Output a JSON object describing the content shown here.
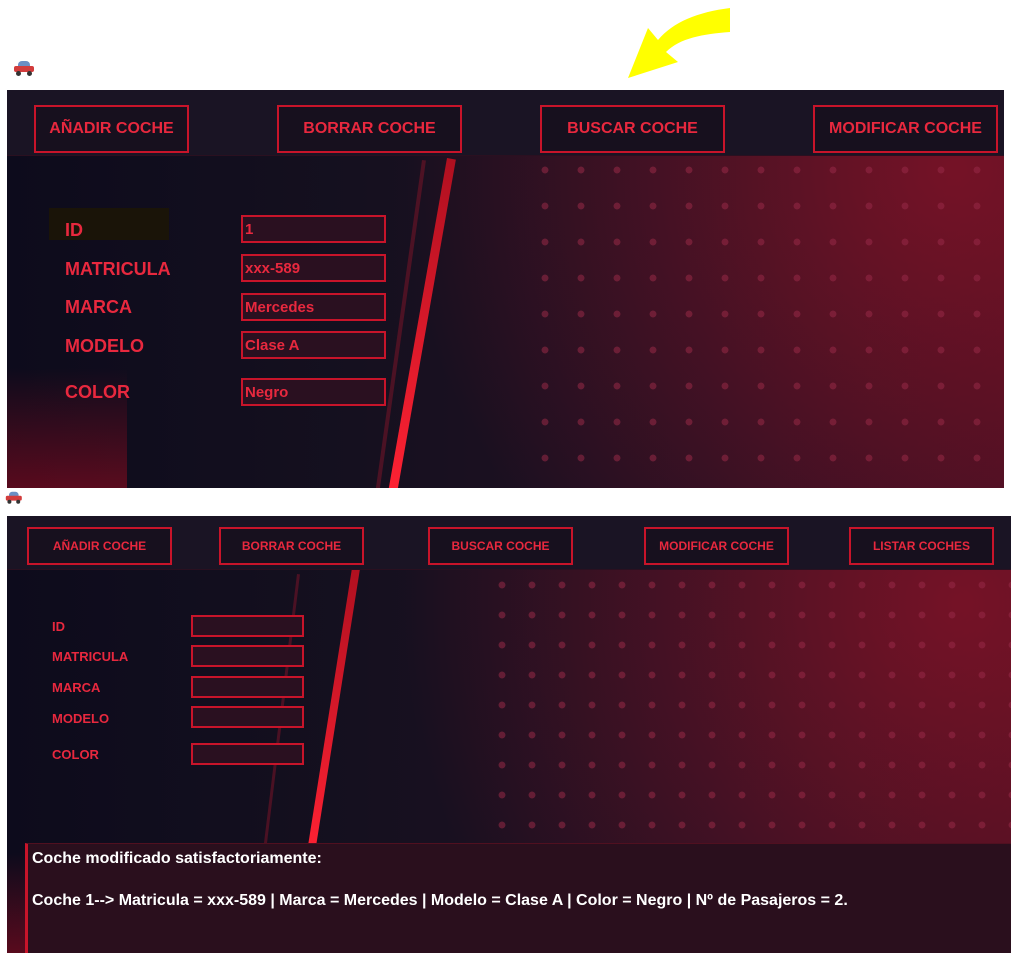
{
  "annotation": {
    "arrow_color": "#ffff00"
  },
  "theme": {
    "accent": "#e8283e",
    "border": "#c8142a",
    "background": "#0d0b1c"
  },
  "window1": {
    "icon": "car-icon",
    "nav": [
      "AÑADIR COCHE",
      "BORRAR COCHE",
      "BUSCAR COCHE",
      "MODIFICAR COCHE"
    ],
    "labels": {
      "id": "ID",
      "matricula": "MATRICULA",
      "marca": "MARCA",
      "modelo": "MODELO",
      "color": "COLOR"
    },
    "values": {
      "id": "1",
      "matricula": "xxx-589",
      "marca": "Mercedes",
      "modelo": "Clase A",
      "color": "Negro"
    }
  },
  "window2": {
    "icon": "car-icon",
    "nav": [
      "AÑADIR COCHE",
      "BORRAR COCHE",
      "BUSCAR COCHE",
      "MODIFICAR COCHE",
      "LISTAR COCHES"
    ],
    "labels": {
      "id": "ID",
      "matricula": "MATRICULA",
      "marca": "MARCA",
      "modelo": "MODELO",
      "color": "COLOR"
    },
    "values": {
      "id": "",
      "matricula": "",
      "marca": "",
      "modelo": "",
      "color": ""
    },
    "message": {
      "title": "Coche modificado satisfactoriamente:",
      "detail": "Coche 1--> Matricula = xxx-589 | Marca = Mercedes | Modelo = Clase A | Color = Negro | Nº de Pasajeros = 2."
    }
  }
}
